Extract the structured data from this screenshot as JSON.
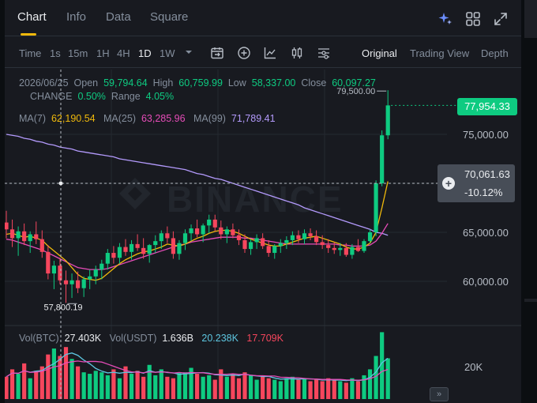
{
  "tabs": [
    {
      "label": "Chart"
    },
    {
      "label": "Info"
    },
    {
      "label": "Data"
    },
    {
      "label": "Square"
    }
  ],
  "header_icons": [
    "ai-sparkle-icon",
    "grid-layout-icon",
    "fullscreen-icon"
  ],
  "toolbar": {
    "intervals": [
      "Time",
      "1s",
      "15m",
      "1H",
      "4H",
      "1D",
      "1W"
    ],
    "selected_interval": "1D",
    "views": [
      "Original",
      "Trading View",
      "Depth"
    ],
    "selected_view": "Original",
    "tool_icons": [
      "calendar-range-icon",
      "add-indicator-icon",
      "chart-line-icon",
      "candlestick-icon",
      "settings-sliders-icon"
    ]
  },
  "ohlc": {
    "date": "2026/06/25",
    "open_label": "Open",
    "open": "59,794.64",
    "high_label": "High",
    "high": "60,759.99",
    "low_label": "Low",
    "low": "58,337.00",
    "close_label": "Close",
    "close": "60,097.27",
    "change_label": "CHANGE",
    "change": "0.50%",
    "range_label": "Range",
    "range": "4.05%"
  },
  "ma": {
    "ma7_label": "MA(7)",
    "ma7": "62,190.54",
    "ma25_label": "MA(25)",
    "ma25": "63,285.96",
    "ma99_label": "MA(99)",
    "ma99": "71,789.41"
  },
  "price_axis": {
    "current_price": "77,954.33",
    "crosshair_price": "70,061.63",
    "crosshair_change": "-10.12%",
    "ticks": [
      "75,000.00",
      "65,000.00",
      "60,000.00"
    ],
    "high_marker": "79,500.00",
    "low_marker": "57,800.19"
  },
  "volume": {
    "vol_btc_label": "Vol(BTC)",
    "vol_btc": "27.403K",
    "vol_usdt_label": "Vol(USDT)",
    "vol_usdt": "1.636B",
    "ma_a": "20.238K",
    "ma_b": "17.709K",
    "axis_tick": "20K"
  },
  "watermark": "BINANCE",
  "expand_label": "»",
  "colors": {
    "up": "#0ecb81",
    "down": "#f6465d",
    "ma7": "#f0b90b",
    "ma25": "#e64cb8",
    "ma99": "#b39afc",
    "accent": "#f0b90b",
    "background": "#181a20"
  },
  "chart_data": {
    "type": "candlestick",
    "interval": "1D",
    "candles": [
      [
        66000,
        67200,
        64400,
        65300
      ],
      [
        65300,
        66300,
        63500,
        64400
      ],
      [
        64400,
        65600,
        62600,
        65100
      ],
      [
        65100,
        65900,
        63700,
        64100
      ],
      [
        64100,
        65100,
        62900,
        64800
      ],
      [
        64800,
        66100,
        63800,
        64300
      ],
      [
        64300,
        65200,
        62400,
        63000
      ],
      [
        63000,
        63700,
        60200,
        60800
      ],
      [
        60800,
        62100,
        59200,
        61600
      ],
      [
        61600,
        62400,
        59700,
        60100
      ],
      [
        60100,
        61100,
        57800,
        59700
      ],
      [
        59700,
        60800,
        58300,
        60100
      ],
      [
        60100,
        61000,
        58800,
        59300
      ],
      [
        59300,
        60500,
        58400,
        60200
      ],
      [
        60200,
        61200,
        59200,
        60500
      ],
      [
        60500,
        61600,
        59700,
        61200
      ],
      [
        61200,
        62200,
        60200,
        61800
      ],
      [
        61800,
        63300,
        61200,
        62900
      ],
      [
        62900,
        63600,
        61800,
        62400
      ],
      [
        62400,
        63900,
        61800,
        63500
      ],
      [
        63500,
        64300,
        62600,
        63000
      ],
      [
        63000,
        64200,
        62200,
        63800
      ],
      [
        63800,
        64800,
        63100,
        63400
      ],
      [
        63400,
        64400,
        62300,
        62800
      ],
      [
        62800,
        63800,
        61900,
        63700
      ],
      [
        63700,
        64700,
        62900,
        64100
      ],
      [
        64100,
        65200,
        63300,
        64900
      ],
      [
        64900,
        65600,
        63900,
        64400
      ],
      [
        64400,
        65100,
        62300,
        62800
      ],
      [
        62800,
        64200,
        62200,
        63900
      ],
      [
        63900,
        65300,
        63200,
        64900
      ],
      [
        64900,
        65800,
        64100,
        65400
      ],
      [
        65400,
        66300,
        64500,
        64800
      ],
      [
        64800,
        65900,
        64000,
        65700
      ],
      [
        65700,
        66800,
        64900,
        66300
      ],
      [
        66300,
        66800,
        65100,
        65500
      ],
      [
        65500,
        66200,
        64300,
        64800
      ],
      [
        64800,
        65600,
        63900,
        65300
      ],
      [
        65300,
        65900,
        64400,
        64700
      ],
      [
        64700,
        65300,
        63700,
        64200
      ],
      [
        64200,
        64800,
        62900,
        63300
      ],
      [
        63300,
        64300,
        62700,
        64000
      ],
      [
        64000,
        64800,
        63300,
        64400
      ],
      [
        64400,
        64900,
        63300,
        63600
      ],
      [
        63600,
        64200,
        62500,
        62900
      ],
      [
        62900,
        63800,
        62300,
        63600
      ],
      [
        63600,
        64300,
        62900,
        63900
      ],
      [
        63900,
        64600,
        63300,
        64200
      ],
      [
        64200,
        65100,
        63700,
        64700
      ],
      [
        64700,
        65200,
        63900,
        64300
      ],
      [
        64300,
        65300,
        63800,
        64900
      ],
      [
        64900,
        65400,
        64200,
        64600
      ],
      [
        64600,
        65200,
        63700,
        64000
      ],
      [
        64000,
        64700,
        63300,
        63700
      ],
      [
        63700,
        64300,
        62900,
        63400
      ],
      [
        63400,
        64000,
        62800,
        63200
      ],
      [
        63200,
        63900,
        62600,
        63400
      ],
      [
        63400,
        63900,
        62500,
        62700
      ],
      [
        62700,
        63800,
        62300,
        63500
      ],
      [
        63500,
        64300,
        63000,
        63100
      ],
      [
        63100,
        64300,
        62900,
        64100
      ],
      [
        64100,
        65300,
        63900,
        65000
      ],
      [
        65000,
        70300,
        64600,
        70000
      ],
      [
        70000,
        75400,
        69700,
        74900
      ],
      [
        74900,
        79500,
        74500,
        77954.33
      ]
    ],
    "ma7": [
      64800,
      64900,
      64700,
      64500,
      64600,
      64400,
      64200,
      63600,
      63100,
      62600,
      62100,
      61400,
      60700,
      60300,
      60200,
      60100,
      60300,
      60800,
      61300,
      61800,
      62200,
      62500,
      62800,
      63000,
      63100,
      63300,
      63500,
      63800,
      63700,
      63600,
      63800,
      64100,
      64400,
      64600,
      64900,
      65100,
      65200,
      65200,
      65100,
      64900,
      64600,
      64300,
      64100,
      63900,
      63700,
      63600,
      63600,
      63800,
      64000,
      64200,
      64400,
      64500,
      64600,
      64400,
      64200,
      64000,
      63800,
      63500,
      63300,
      63300,
      63500,
      63900,
      65000,
      67500,
      70200
    ],
    "ma25": [
      64300,
      64200,
      64000,
      63800,
      63600,
      63400,
      63200,
      62900,
      62600,
      62300,
      62000,
      61700,
      61400,
      61300,
      61200,
      61200,
      61200,
      61300,
      61500,
      61700,
      61900,
      62100,
      62300,
      62500,
      62700,
      62900,
      63100,
      63300,
      63500,
      63700,
      63800,
      64000,
      64100,
      64200,
      64300,
      64400,
      64500,
      64500,
      64500,
      64500,
      64400,
      64400,
      64300,
      64200,
      64100,
      64000,
      63900,
      63800,
      63800,
      63800,
      63800,
      63800,
      63800,
      63800,
      63800,
      63800,
      63700,
      63700,
      63600,
      63600,
      63600,
      63700,
      64100,
      64900,
      65900
    ],
    "ma99": [
      75000,
      74900,
      74800,
      74600,
      74500,
      74300,
      74200,
      74000,
      73900,
      73700,
      73600,
      73500,
      73300,
      73200,
      73100,
      73000,
      72900,
      72800,
      72700,
      72500,
      72400,
      72300,
      72200,
      72100,
      72000,
      71900,
      71800,
      71700,
      71600,
      71500,
      71400,
      71200,
      71000,
      70900,
      70700,
      70500,
      70400,
      70200,
      70000,
      69800,
      69600,
      69400,
      69200,
      69000,
      68800,
      68600,
      68400,
      68200,
      68000,
      67800,
      67500,
      67300,
      67100,
      66900,
      66700,
      66500,
      66300,
      66100,
      65900,
      65700,
      65500,
      65300,
      65000,
      64900,
      64700
    ],
    "volume_btc_k": [
      15,
      20,
      17,
      24,
      14,
      19,
      22,
      30,
      34,
      29,
      35,
      27,
      22,
      18,
      17,
      19,
      18,
      16,
      20,
      14,
      22,
      17,
      19,
      15,
      23,
      16,
      20,
      15,
      14,
      18,
      18,
      21,
      17,
      15,
      16,
      13,
      20,
      15,
      17,
      14,
      18,
      16,
      13,
      15,
      14,
      13,
      12,
      14,
      15,
      13,
      14,
      12,
      13,
      12,
      14,
      13,
      12,
      11,
      14,
      12,
      16,
      20,
      29,
      45,
      27.403
    ],
    "ylim": [
      57000,
      80500
    ],
    "y_ticks": [
      60000,
      65000,
      75000
    ]
  }
}
